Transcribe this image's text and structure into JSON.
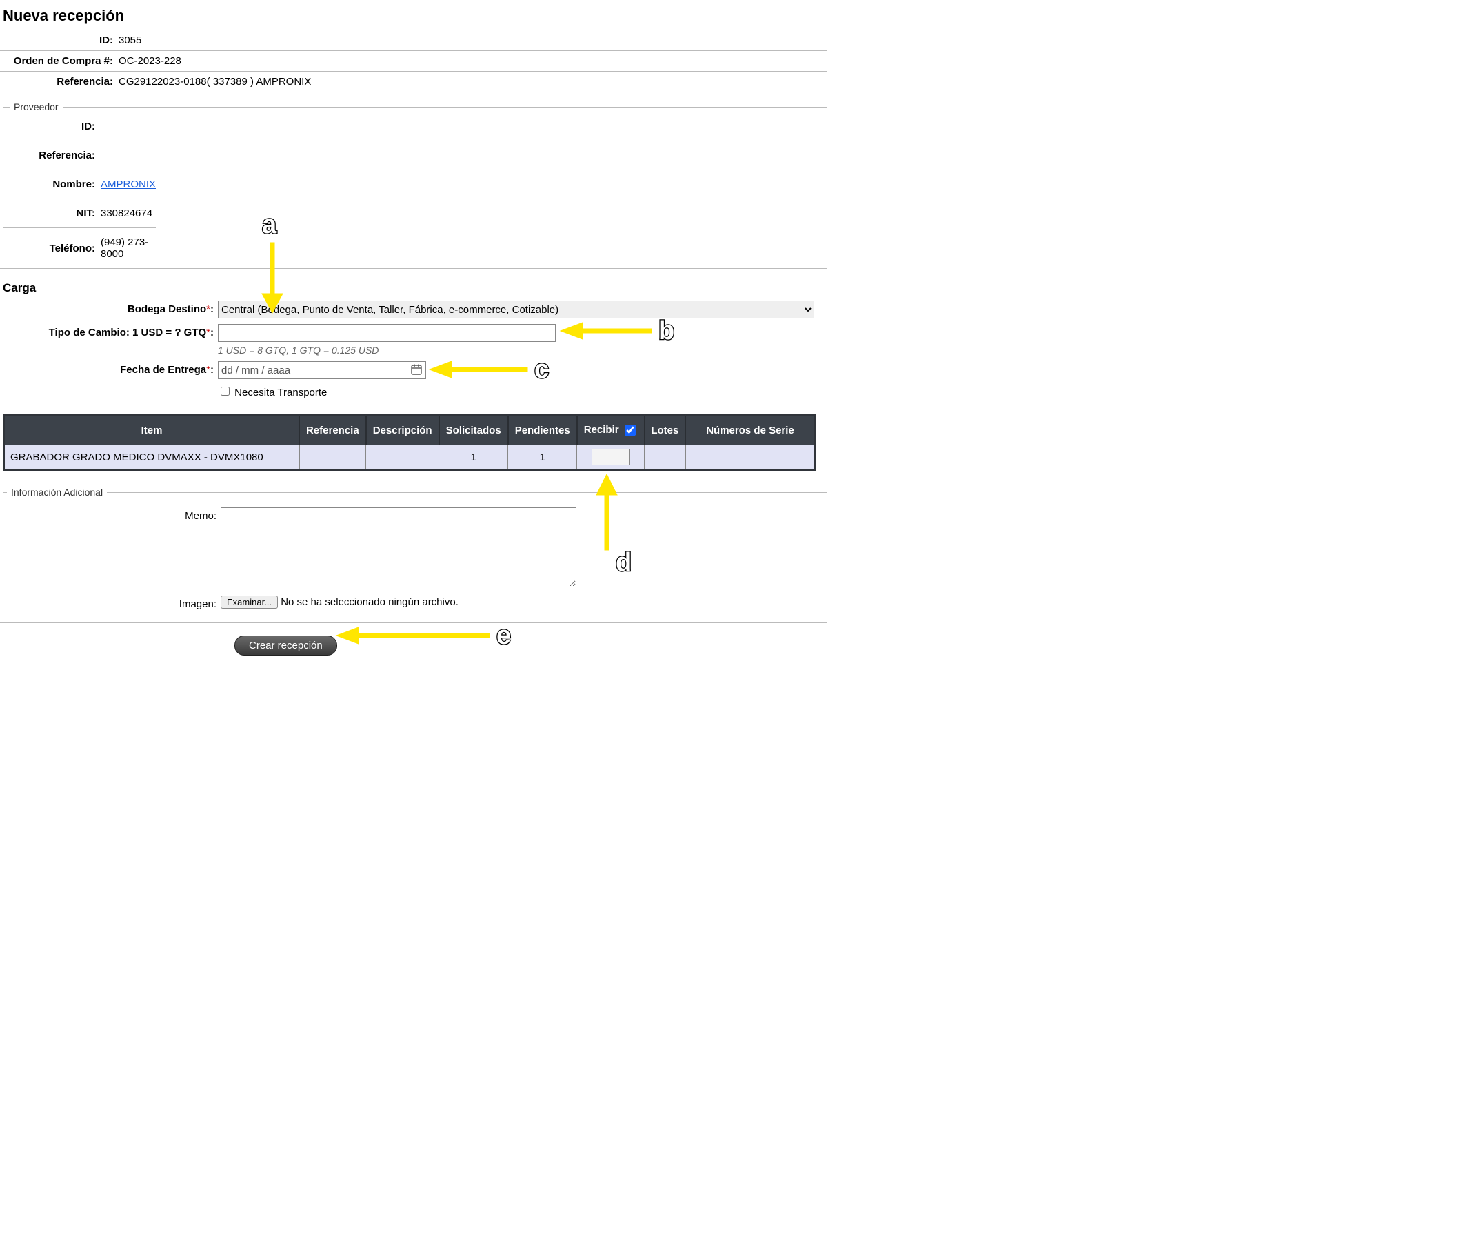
{
  "page_title": "Nueva recepción",
  "header": {
    "id_label": "ID:",
    "id_value": "3055",
    "oc_label": "Orden de Compra #:",
    "oc_value": "OC-2023-228",
    "ref_label": "Referencia:",
    "ref_value": "CG29122023-0188( 337389 ) AMPRONIX"
  },
  "proveedor": {
    "legend": "Proveedor",
    "id_label": "ID:",
    "id_value": "",
    "ref_label": "Referencia:",
    "ref_value": "",
    "nombre_label": "Nombre:",
    "nombre_link": "AMPRONIX",
    "nit_label": "NIT:",
    "nit_value": "330824674",
    "tel_label": "Teléfono:",
    "tel_value": "(949) 273-8000"
  },
  "carga": {
    "section_title": "Carga",
    "bodega_label": "Bodega Destino",
    "bodega_selected": "Central (Bodega, Punto de Venta, Taller, Fábrica, e-commerce, Cotizable)",
    "tipo_cambio_label": "Tipo de Cambio: 1 USD = ? GTQ",
    "tipo_cambio_value": "",
    "tipo_cambio_helper": "1 USD = 8 GTQ, 1 GTQ = 0.125 USD",
    "fecha_label": "Fecha de Entrega",
    "fecha_placeholder": "dd / mm / aaaa",
    "transporte_label": "Necesita Transporte",
    "transporte_checked": false
  },
  "items_table": {
    "headers": {
      "item": "Item",
      "referencia": "Referencia",
      "descripcion": "Descripción",
      "solicitados": "Solicitados",
      "pendientes": "Pendientes",
      "recibir": "Recibir",
      "lotes": "Lotes",
      "serie": "Números de Serie"
    },
    "rows": [
      {
        "item": "GRABADOR GRADO MEDICO DVMAXX - DVMX1080",
        "referencia": "",
        "descripcion": "",
        "solicitados": "1",
        "pendientes": "1",
        "recibir": "",
        "lotes": "",
        "serie": ""
      }
    ]
  },
  "adicional": {
    "legend": "Información Adicional",
    "memo_label": "Memo:",
    "memo_value": "",
    "imagen_label": "Imagen:",
    "examinar_label": "Examinar...",
    "no_file_text": "No se ha seleccionado ningún archivo."
  },
  "actions": {
    "create_label": "Crear recepción"
  },
  "annotations": {
    "a": "a",
    "b": "b",
    "c": "c",
    "d": "d",
    "e": "e"
  }
}
